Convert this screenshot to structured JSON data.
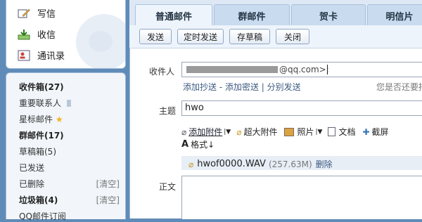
{
  "sidebar": {
    "actions": [
      {
        "label": "写信",
        "icon": "write-icon"
      },
      {
        "label": "收信",
        "icon": "inbox-download-icon"
      },
      {
        "label": "通讯录",
        "icon": "contacts-icon"
      }
    ],
    "folders": [
      {
        "label": "收件箱(27)",
        "bold": true
      },
      {
        "label": "重要联系人",
        "icon": "bookmark-icon"
      },
      {
        "label": "星标邮件",
        "icon": "star-icon"
      },
      {
        "label": "群邮件(17)",
        "bold": true
      },
      {
        "label": "草稿箱(5)"
      },
      {
        "label": "已发送"
      },
      {
        "label": "已删除",
        "action": "[清空]"
      },
      {
        "label": "垃圾箱(4)",
        "bold": true,
        "action": "[清空]"
      },
      {
        "label": "QQ邮件订阅"
      }
    ]
  },
  "tabs": [
    "普通邮件",
    "群邮件",
    "贺卡",
    "明信片"
  ],
  "toolbar": {
    "send": "发送",
    "schedule": "定时发送",
    "save_draft": "存草稿",
    "close": "关闭"
  },
  "compose": {
    "to_label": "收件人",
    "to_value": "@qq.com>;",
    "cc_links": "添加抄送 - 添加密送 | 分别发送",
    "right_hint": "您是否还要把",
    "subject_label": "主题",
    "subject_value": "hwo",
    "attach": "添加附件",
    "big_attach": "超大附件",
    "photo": "照片",
    "doc": "文档",
    "screenshot": "截屏",
    "format": "格式↓",
    "file_name": "hwof0000.WAV",
    "file_size": "(257.63M)",
    "file_delete": "删除",
    "body_label": "正文"
  },
  "colors": {
    "accent_bg": "#5f8bb8",
    "link": "#3d5a80"
  }
}
